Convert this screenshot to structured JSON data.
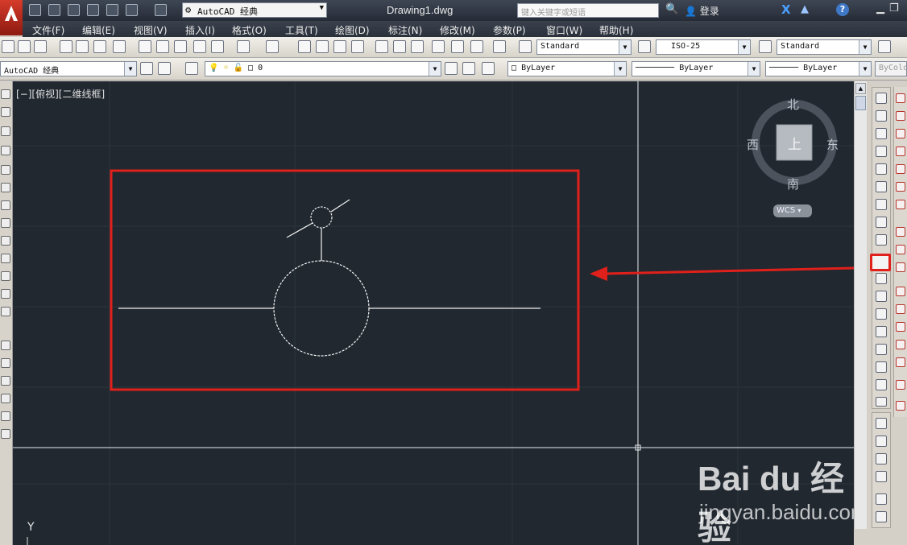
{
  "title_bar": {
    "workspace": "AutoCAD 经典",
    "document_title": "Drawing1.dwg",
    "search_placeholder": "键入关键字或短语",
    "login_label": "登录"
  },
  "menu": {
    "items": [
      "文件(F)",
      "编辑(E)",
      "视图(V)",
      "插入(I)",
      "格式(O)",
      "工具(T)",
      "绘图(D)",
      "标注(N)",
      "修改(M)",
      "参数(P)",
      "窗口(W)",
      "帮助(H)"
    ]
  },
  "styles_toolbar": {
    "text_style": "Standard",
    "dim_style": "ISO-25",
    "table_style": "Standard"
  },
  "layers_toolbar": {
    "workspace_combo": "AutoCAD 经典",
    "current_layer": "0",
    "color": "ByLayer",
    "linetype": "ByLayer",
    "lineweight": "ByLayer",
    "plot_style": "ByColo"
  },
  "canvas": {
    "viewport_label": "[−][俯视][二维线框]",
    "viewcube": {
      "north": "北",
      "south": "南",
      "east": "东",
      "west": "西",
      "top_face": "上",
      "ucs_badge": "WCS"
    },
    "y_axis_label": "Y",
    "highlight_color": "#e0201a",
    "background_color": "#212830"
  },
  "watermark": {
    "logo_text": "Bai du 经验",
    "url": "jingyan.baidu.com"
  },
  "icons": {
    "modify_tools": [
      "erase-icon",
      "copy-icon",
      "mirror-icon",
      "offset-icon",
      "array-icon",
      "move-icon",
      "rotate-icon",
      "scale-icon",
      "stretch-icon",
      "trim-icon",
      "extend-icon",
      "break-at-point-icon",
      "break-icon",
      "join-icon",
      "chamfer-icon",
      "fillet-icon",
      "blend-icon",
      "explode-icon"
    ]
  }
}
